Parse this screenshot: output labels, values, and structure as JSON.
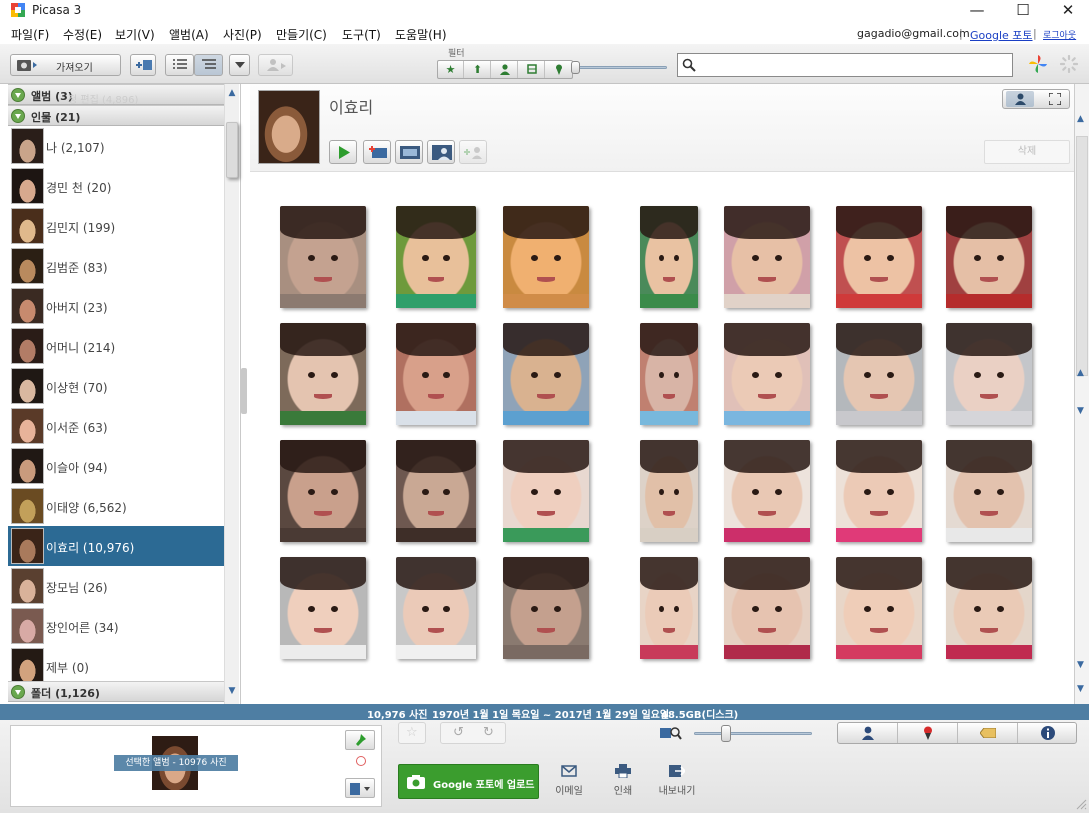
{
  "window": {
    "title": "Picasa 3",
    "minimize": "—",
    "maximize": "☐",
    "close": "✕"
  },
  "menu": [
    {
      "label": "파일(F)"
    },
    {
      "label": "수정(E)"
    },
    {
      "label": "보기(V)"
    },
    {
      "label": "앨범(A)"
    },
    {
      "label": "사진(P)"
    },
    {
      "label": "만들기(C)"
    },
    {
      "label": "도구(T)"
    },
    {
      "label": "도움말(H)"
    }
  ],
  "account": {
    "email": "gagadio@gmail.com",
    "sep": "|",
    "google_photos": "Google 포토",
    "logout": "로그아웃"
  },
  "toolbar": {
    "import_label": "가져오기",
    "filter_label": "필터",
    "search_placeholder": ""
  },
  "sidebar": {
    "albums_header": "앨범 (3)",
    "behind_text": "정 편집 (4,896)",
    "people_header": "인물 (21)",
    "folders_header": "폴더 (1,126)",
    "people": [
      {
        "name": "나 (2,107)",
        "skin": "#c9a48a",
        "hair": "#2a1e19"
      },
      {
        "name": "경민 천 (20)",
        "skin": "#d7a98e",
        "hair": "#1d1512"
      },
      {
        "name": "김민지 (199)",
        "skin": "#e0b98c",
        "hair": "#4a2e1b"
      },
      {
        "name": "김범준 (83)",
        "skin": "#b98a5e",
        "hair": "#2b1f14"
      },
      {
        "name": "아버지 (23)",
        "skin": "#c78a6e",
        "hair": "#3a2a22"
      },
      {
        "name": "어머니 (214)",
        "skin": "#b27c66",
        "hair": "#2a1c17"
      },
      {
        "name": "이상현 (70)",
        "skin": "#d9b8a0",
        "hair": "#1f1814"
      },
      {
        "name": "이서준 (63)",
        "skin": "#e8b39a",
        "hair": "#5a3a28"
      },
      {
        "name": "이슬아 (94)",
        "skin": "#c99b7d",
        "hair": "#201814"
      },
      {
        "name": "이태양 (6,562)",
        "skin": "#c2a05a",
        "hair": "#6a4b22"
      },
      {
        "name": "이효리 (10,976)",
        "skin": "#a97a5c",
        "hair": "#3a2418",
        "selected": true
      },
      {
        "name": "장모님 (26)",
        "skin": "#d9b29a",
        "hair": "#5a4030"
      },
      {
        "name": "장인어른 (34)",
        "skin": "#d8aaa5",
        "hair": "#7a5a50"
      },
      {
        "name": "제부 (0)",
        "skin": "#d2a37e",
        "hair": "#241a14"
      }
    ]
  },
  "main": {
    "person_title": "이효리",
    "delete_label": "삭제"
  },
  "grid": {
    "thumbs": [
      {
        "skin": "#c4a290",
        "bg": "#a88f80",
        "clothes": "#8c7a70"
      },
      {
        "skin": "#e8c09a",
        "bg": "#6e9a3c",
        "clothes": "#2f9f6a"
      },
      {
        "skin": "#f0b070",
        "bg": "#c98a40",
        "clothes": "#d08c48"
      },
      {
        "skin": "#e9c2a2",
        "bg": "#4a8a5a",
        "clothes": "#3b8b4a"
      },
      {
        "skin": "#e7c0a6",
        "bg": "#d0a0a8",
        "clothes": "#e1d2c8"
      },
      {
        "skin": "#edc2a4",
        "bg": "#c05050",
        "clothes": "#cf3a3a"
      },
      {
        "skin": "#e5bfa6",
        "bg": "#a04040",
        "clothes": "#b52c2c"
      },
      {
        "skin": "#e4c4b0",
        "bg": "#7d6a5a",
        "clothes": "#3a7a3a"
      },
      {
        "skin": "#d8a08a",
        "bg": "#b07060",
        "clothes": "#d9e0e8"
      },
      {
        "skin": "#d9b290",
        "bg": "#8fa3b8",
        "clothes": "#5ca0d0"
      },
      {
        "skin": "#d8b4a6",
        "bg": "#c08070",
        "clothes": "#78b8dc"
      },
      {
        "skin": "#ebcab6",
        "bg": "#e0c0b8",
        "clothes": "#7ab6df"
      },
      {
        "skin": "#e5c6b2",
        "bg": "#b4b8bc",
        "clothes": "#c8c8cc"
      },
      {
        "skin": "#ead0c4",
        "bg": "#c4c6ca",
        "clothes": "#d5d5d9"
      },
      {
        "skin": "#c9a08c",
        "bg": "#5a4840",
        "clothes": "#4a3a34"
      },
      {
        "skin": "#c9a894",
        "bg": "#6e5850",
        "clothes": "#3e2e28"
      },
      {
        "skin": "#efcfbf",
        "bg": "#e8d8d0",
        "clothes": "#3a9a5a"
      },
      {
        "skin": "#e1c0a8",
        "bg": "#ddd2c8",
        "clothes": "#d8cfc4"
      },
      {
        "skin": "#e9c8b4",
        "bg": "#ede3dc",
        "clothes": "#cc2f6a"
      },
      {
        "skin": "#eccab6",
        "bg": "#ede1d8",
        "clothes": "#e03a78"
      },
      {
        "skin": "#e3c2ae",
        "bg": "#e4dad2",
        "clothes": "#e8e8e8"
      },
      {
        "skin": "#efcfbd",
        "bg": "#b8b8b8",
        "clothes": "#ececec"
      },
      {
        "skin": "#ebcab8",
        "bg": "#c8c8c8",
        "clothes": "#f0f0f0"
      },
      {
        "skin": "#c4a08e",
        "bg": "#8a7a70",
        "clothes": "#7a6a62"
      },
      {
        "skin": "#ebcbb8",
        "bg": "#e8d4c6",
        "clothes": "#c83a5a"
      },
      {
        "skin": "#e6c3b0",
        "bg": "#e6d0c2",
        "clothes": "#b02a4a"
      },
      {
        "skin": "#efcdb8",
        "bg": "#e8d6c8",
        "clothes": "#d43a60"
      },
      {
        "skin": "#eacab6",
        "bg": "#e4d6ca",
        "clothes": "#c02a50"
      }
    ]
  },
  "status": {
    "count": "10,976 사진",
    "range": "1970년 1월 1일 목요일 ~ 2017년 1월 29일 일요일",
    "size": "48.5GB(디스크)"
  },
  "tray": {
    "selected_label": "선택한 앨범 - 10976 사진"
  },
  "actions": {
    "upload": "Google 포토에 업로드",
    "email": "이메일",
    "print": "인쇄",
    "export": "내보내기"
  },
  "colors": {
    "accent": "#2c6a94",
    "status_bar": "#4e7ea3",
    "upload_green": "#3b9d2e"
  }
}
